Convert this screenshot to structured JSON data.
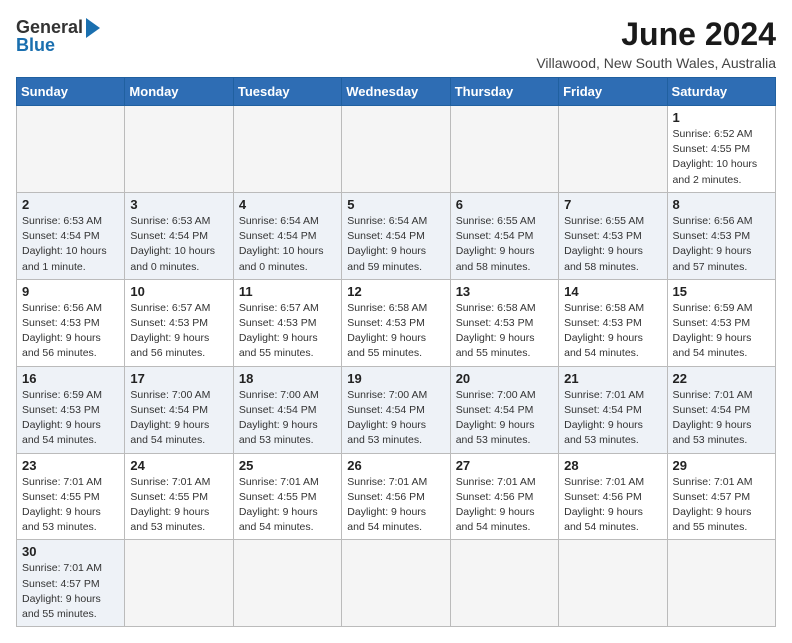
{
  "header": {
    "logo_general": "General",
    "logo_blue": "Blue",
    "month": "June 2024",
    "location": "Villawood, New South Wales, Australia"
  },
  "weekdays": [
    "Sunday",
    "Monday",
    "Tuesday",
    "Wednesday",
    "Thursday",
    "Friday",
    "Saturday"
  ],
  "weeks": [
    [
      {
        "day": null,
        "info": ""
      },
      {
        "day": null,
        "info": ""
      },
      {
        "day": null,
        "info": ""
      },
      {
        "day": null,
        "info": ""
      },
      {
        "day": null,
        "info": ""
      },
      {
        "day": null,
        "info": ""
      },
      {
        "day": "1",
        "info": "Sunrise: 6:52 AM\nSunset: 4:55 PM\nDaylight: 10 hours\nand 2 minutes."
      }
    ],
    [
      {
        "day": "2",
        "info": "Sunrise: 6:53 AM\nSunset: 4:54 PM\nDaylight: 10 hours\nand 1 minute."
      },
      {
        "day": "3",
        "info": "Sunrise: 6:53 AM\nSunset: 4:54 PM\nDaylight: 10 hours\nand 0 minutes."
      },
      {
        "day": "4",
        "info": "Sunrise: 6:54 AM\nSunset: 4:54 PM\nDaylight: 10 hours\nand 0 minutes."
      },
      {
        "day": "5",
        "info": "Sunrise: 6:54 AM\nSunset: 4:54 PM\nDaylight: 9 hours\nand 59 minutes."
      },
      {
        "day": "6",
        "info": "Sunrise: 6:55 AM\nSunset: 4:54 PM\nDaylight: 9 hours\nand 58 minutes."
      },
      {
        "day": "7",
        "info": "Sunrise: 6:55 AM\nSunset: 4:53 PM\nDaylight: 9 hours\nand 58 minutes."
      },
      {
        "day": "8",
        "info": "Sunrise: 6:56 AM\nSunset: 4:53 PM\nDaylight: 9 hours\nand 57 minutes."
      }
    ],
    [
      {
        "day": "9",
        "info": "Sunrise: 6:56 AM\nSunset: 4:53 PM\nDaylight: 9 hours\nand 56 minutes."
      },
      {
        "day": "10",
        "info": "Sunrise: 6:57 AM\nSunset: 4:53 PM\nDaylight: 9 hours\nand 56 minutes."
      },
      {
        "day": "11",
        "info": "Sunrise: 6:57 AM\nSunset: 4:53 PM\nDaylight: 9 hours\nand 55 minutes."
      },
      {
        "day": "12",
        "info": "Sunrise: 6:58 AM\nSunset: 4:53 PM\nDaylight: 9 hours\nand 55 minutes."
      },
      {
        "day": "13",
        "info": "Sunrise: 6:58 AM\nSunset: 4:53 PM\nDaylight: 9 hours\nand 55 minutes."
      },
      {
        "day": "14",
        "info": "Sunrise: 6:58 AM\nSunset: 4:53 PM\nDaylight: 9 hours\nand 54 minutes."
      },
      {
        "day": "15",
        "info": "Sunrise: 6:59 AM\nSunset: 4:53 PM\nDaylight: 9 hours\nand 54 minutes."
      }
    ],
    [
      {
        "day": "16",
        "info": "Sunrise: 6:59 AM\nSunset: 4:53 PM\nDaylight: 9 hours\nand 54 minutes."
      },
      {
        "day": "17",
        "info": "Sunrise: 7:00 AM\nSunset: 4:54 PM\nDaylight: 9 hours\nand 54 minutes."
      },
      {
        "day": "18",
        "info": "Sunrise: 7:00 AM\nSunset: 4:54 PM\nDaylight: 9 hours\nand 53 minutes."
      },
      {
        "day": "19",
        "info": "Sunrise: 7:00 AM\nSunset: 4:54 PM\nDaylight: 9 hours\nand 53 minutes."
      },
      {
        "day": "20",
        "info": "Sunrise: 7:00 AM\nSunset: 4:54 PM\nDaylight: 9 hours\nand 53 minutes."
      },
      {
        "day": "21",
        "info": "Sunrise: 7:01 AM\nSunset: 4:54 PM\nDaylight: 9 hours\nand 53 minutes."
      },
      {
        "day": "22",
        "info": "Sunrise: 7:01 AM\nSunset: 4:54 PM\nDaylight: 9 hours\nand 53 minutes."
      }
    ],
    [
      {
        "day": "23",
        "info": "Sunrise: 7:01 AM\nSunset: 4:55 PM\nDaylight: 9 hours\nand 53 minutes."
      },
      {
        "day": "24",
        "info": "Sunrise: 7:01 AM\nSunset: 4:55 PM\nDaylight: 9 hours\nand 53 minutes."
      },
      {
        "day": "25",
        "info": "Sunrise: 7:01 AM\nSunset: 4:55 PM\nDaylight: 9 hours\nand 54 minutes."
      },
      {
        "day": "26",
        "info": "Sunrise: 7:01 AM\nSunset: 4:56 PM\nDaylight: 9 hours\nand 54 minutes."
      },
      {
        "day": "27",
        "info": "Sunrise: 7:01 AM\nSunset: 4:56 PM\nDaylight: 9 hours\nand 54 minutes."
      },
      {
        "day": "28",
        "info": "Sunrise: 7:01 AM\nSunset: 4:56 PM\nDaylight: 9 hours\nand 54 minutes."
      },
      {
        "day": "29",
        "info": "Sunrise: 7:01 AM\nSunset: 4:57 PM\nDaylight: 9 hours\nand 55 minutes."
      }
    ],
    [
      {
        "day": "30",
        "info": "Sunrise: 7:01 AM\nSunset: 4:57 PM\nDaylight: 9 hours\nand 55 minutes."
      },
      {
        "day": null,
        "info": ""
      },
      {
        "day": null,
        "info": ""
      },
      {
        "day": null,
        "info": ""
      },
      {
        "day": null,
        "info": ""
      },
      {
        "day": null,
        "info": ""
      },
      {
        "day": null,
        "info": ""
      }
    ]
  ]
}
